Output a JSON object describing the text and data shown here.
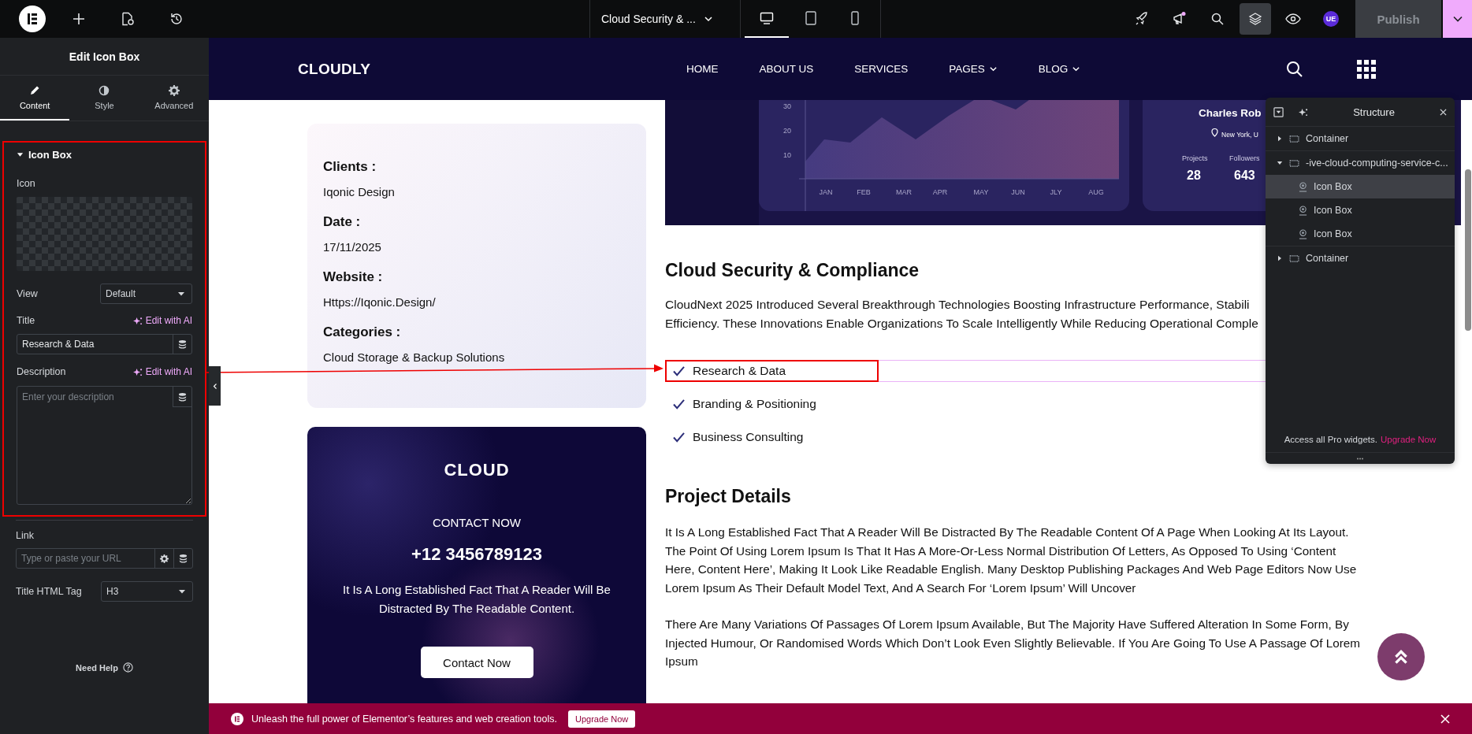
{
  "topbar": {
    "title": "Cloud Security & ...",
    "devices": [
      {
        "kind": "desktop",
        "selected": true
      },
      {
        "kind": "tablet",
        "selected": false
      },
      {
        "kind": "mobile",
        "selected": false
      }
    ],
    "avatar": "UE",
    "publish": "Publish"
  },
  "panel": {
    "title": "Edit Icon Box",
    "tabs": [
      {
        "label": "Content",
        "kind": "content",
        "selected": true
      },
      {
        "label": "Style",
        "kind": "style",
        "selected": false
      },
      {
        "label": "Advanced",
        "kind": "advanced",
        "selected": false
      }
    ],
    "section": {
      "title": "Icon Box",
      "expanded": true
    },
    "icon_label": "Icon",
    "view": {
      "label": "View",
      "value": "Default"
    },
    "title_field": {
      "label": "Title",
      "ai": "Edit with AI",
      "value": "Research & Data"
    },
    "description": {
      "label": "Description",
      "ai": "Edit with AI",
      "placeholder": "Enter your description"
    },
    "link": {
      "label": "Link",
      "placeholder": "Type or paste your URL"
    },
    "title_tag": {
      "label": "Title HTML Tag",
      "value": "H3"
    },
    "help": "Need Help"
  },
  "site": {
    "logo": "CLOUDLY",
    "nav": [
      {
        "label": "HOME",
        "dropdown": false
      },
      {
        "label": "ABOUT US",
        "dropdown": false
      },
      {
        "label": "SERVICES",
        "dropdown": false
      },
      {
        "label": "PAGES",
        "dropdown": true
      },
      {
        "label": "BLOG",
        "dropdown": true
      }
    ]
  },
  "info_card": [
    {
      "label": "Clients :",
      "value": "Iqonic Design"
    },
    {
      "label": "Date :",
      "value": "17/11/2025"
    },
    {
      "label": "Website :",
      "value": "Https://Iqonic.Design/"
    },
    {
      "label": "Categories :",
      "value": "Cloud Storage & Backup Solutions"
    }
  ],
  "contact_card": {
    "title": "CLOUD",
    "subtitle": "CONTACT NOW",
    "phone": "+12 3456789123",
    "text": "It Is A Long Established Fact That A Reader Will Be Distracted By The Readable Content.",
    "button": "Contact Now"
  },
  "dashboard": {
    "yticks": [
      "30",
      "20",
      "10"
    ],
    "months": [
      "JAN",
      "FEB",
      "MAR",
      "APR",
      "MAY",
      "JUN",
      "JLY",
      "AUG"
    ],
    "name": "Charles Rob",
    "location": "New York, U",
    "stats": [
      {
        "label": "Projects",
        "value": "28"
      },
      {
        "label": "Followers",
        "value": "643"
      }
    ]
  },
  "security": {
    "heading": "Cloud Security & Compliance",
    "lines": [
      "CloudNext 2025 Introduced Several Breakthrough Technologies Boosting Infrastructure Performance, Stabili",
      "Efficiency. These Innovations Enable Organizations To Scale Intelligently While Reducing Operational Comple"
    ],
    "checklist": [
      {
        "label": "Research & Data",
        "selected": true
      },
      {
        "label": "Branding & Positioning",
        "selected": false
      },
      {
        "label": "Business Consulting",
        "selected": false
      }
    ]
  },
  "project": {
    "heading": "Project Details",
    "paragraphs": [
      "It Is A Long Established Fact That A Reader Will Be Distracted By The Readable Content Of A Page When Looking At Its Layout. The Point Of Using Lorem Ipsum Is That It Has A More-Or-Less Normal Distribution Of Letters, As Opposed To Using ‘Content Here, Content Here’, Making It Look Like Readable English. Many Desktop Publishing Packages And Web Page Editors Now Use Lorem Ipsum As Their Default Model Text, And A Search For ‘Lorem Ipsum’ Will Uncover",
      "There Are Many Variations Of Passages Of Lorem Ipsum Available, But The Majority Have Suffered Alteration In Some Form, By Injected Humour, Or Randomised Words Which Don’t Look Even Slightly Believable. If You Are Going To Use A Passage Of Lorem Ipsum"
    ]
  },
  "structure": {
    "title": "Structure",
    "items": [
      {
        "label": "Container",
        "kind": "container",
        "expanded": false,
        "selected": false
      },
      {
        "label": "-ive-cloud-computing-service-c...",
        "kind": "container",
        "expanded": true,
        "selected": false,
        "children": [
          {
            "label": "Icon Box",
            "kind": "widget",
            "selected": true
          },
          {
            "label": "Icon Box",
            "kind": "widget",
            "selected": false
          },
          {
            "label": "Icon Box",
            "kind": "widget",
            "selected": false
          }
        ]
      },
      {
        "label": "Container",
        "kind": "container",
        "expanded": false,
        "selected": false
      }
    ],
    "footer": "Access all Pro widgets.",
    "upgrade": "Upgrade Now"
  },
  "promo": {
    "text": "Unleash the full power of Elementor’s features and web creation tools.",
    "button": "Upgrade Now"
  }
}
